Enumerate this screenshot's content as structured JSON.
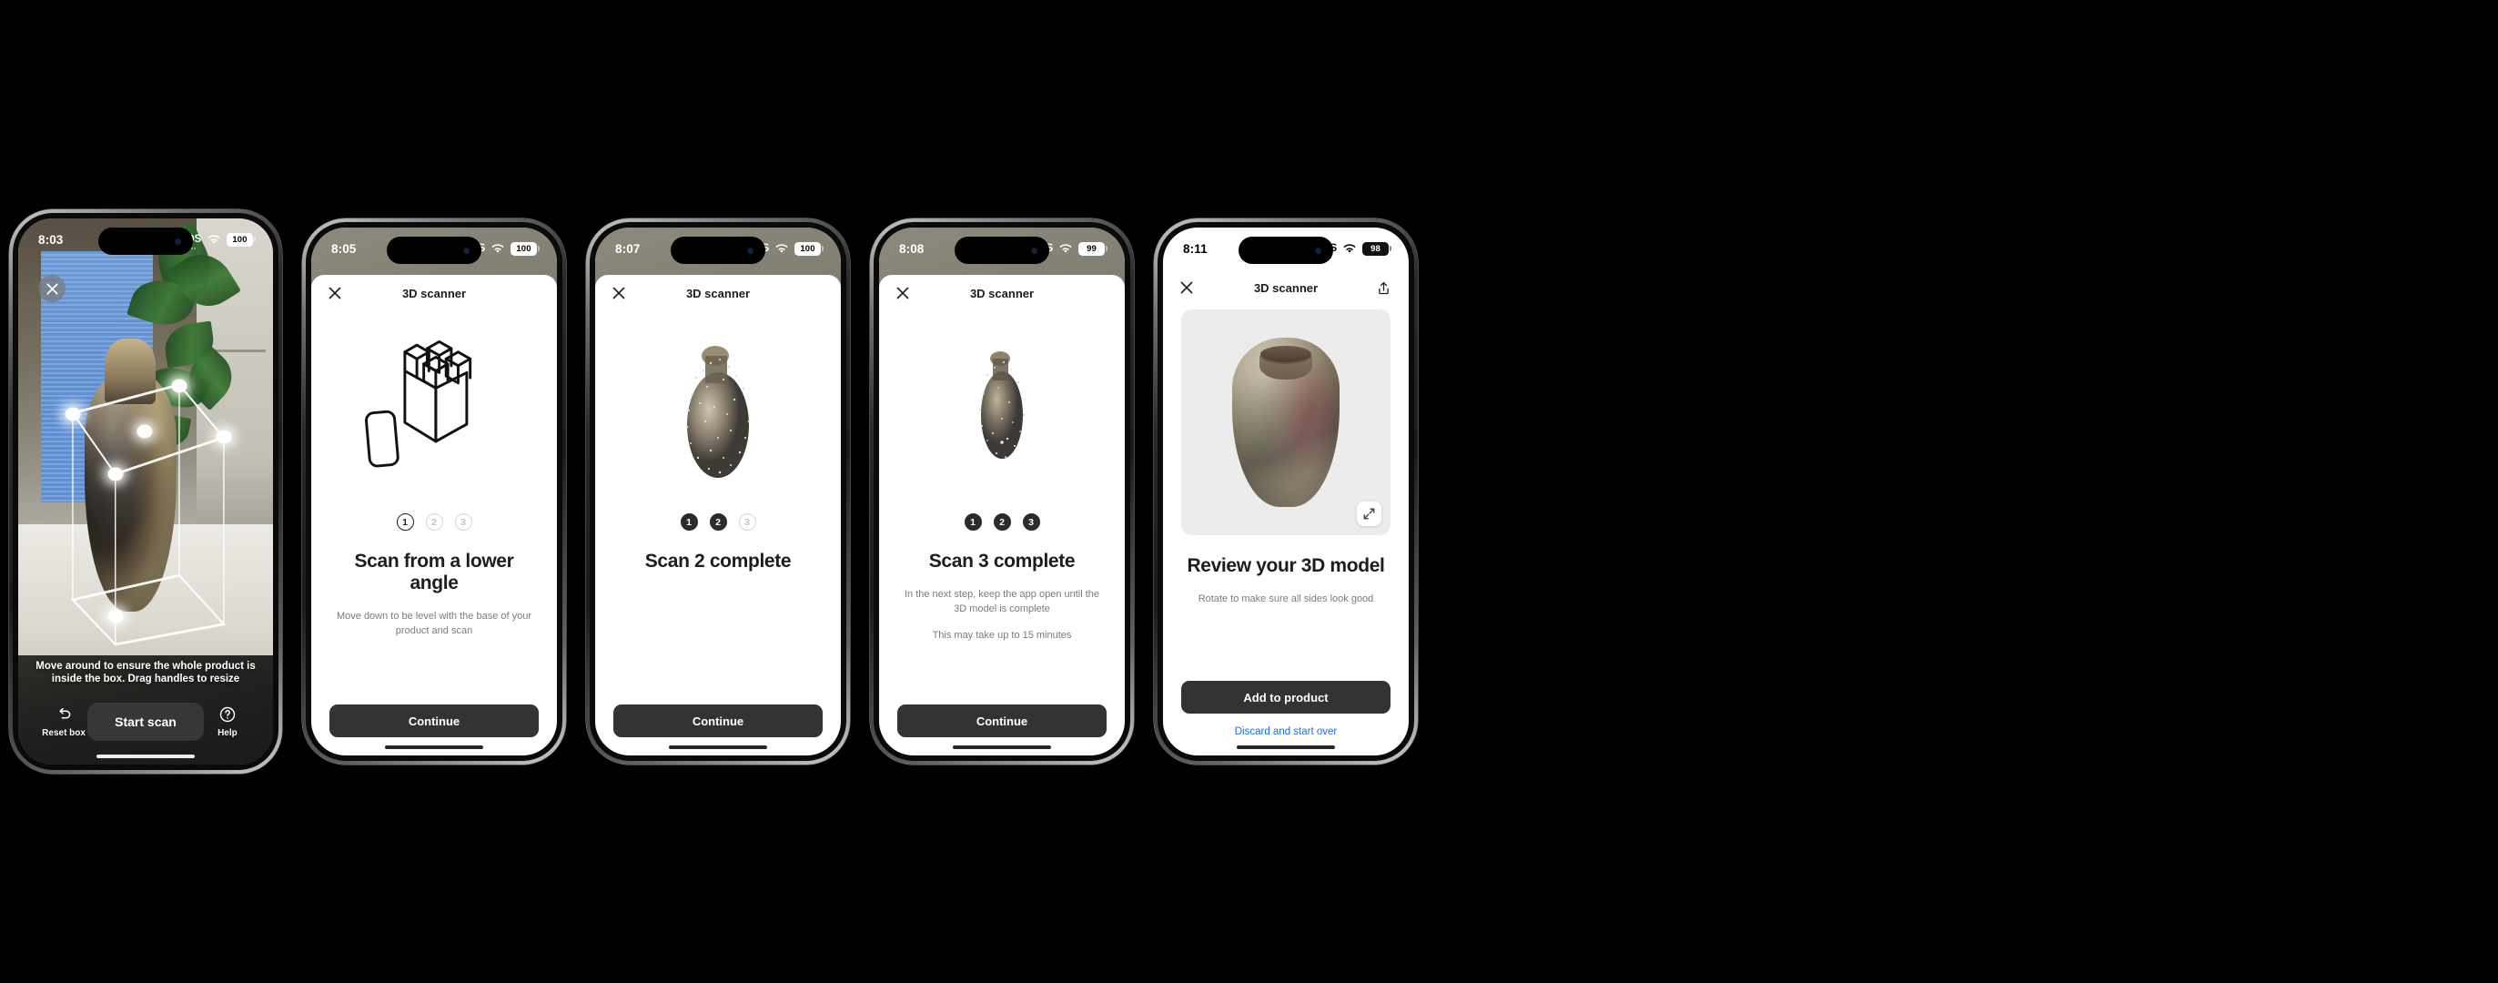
{
  "screens": [
    {
      "id": "ar-box",
      "status": {
        "time": "8:03",
        "sos": "SOS",
        "battery": "100",
        "wifi_icon": "wifi-icon"
      },
      "close_icon": "close-icon",
      "hint": "Move around to ensure the whole product is inside the box. Drag handles to resize",
      "reset": {
        "label": "Reset box",
        "icon": "undo-icon"
      },
      "start": {
        "label": "Start scan"
      },
      "help": {
        "label": "Help",
        "icon": "question-circle-icon"
      }
    },
    {
      "id": "scan-1",
      "status": {
        "time": "8:05",
        "sos": "SOS",
        "battery": "100",
        "wifi_icon": "wifi-icon"
      },
      "title": "3D scanner",
      "close_icon": "close-icon",
      "illustration": "isometric-box-with-phone-icon",
      "steps": [
        {
          "label": "1",
          "state": "current"
        },
        {
          "label": "2",
          "state": "todo"
        },
        {
          "label": "3",
          "state": "todo"
        }
      ],
      "headline": "Scan from a lower angle",
      "subline": "Move down to be level with the base of your product and scan",
      "primary": "Continue"
    },
    {
      "id": "scan-2",
      "status": {
        "time": "8:07",
        "sos": "SOS",
        "battery": "100",
        "wifi_icon": "wifi-icon"
      },
      "title": "3D scanner",
      "close_icon": "close-icon",
      "illustration": "point-cloud-vase",
      "steps": [
        {
          "label": "1",
          "state": "done"
        },
        {
          "label": "2",
          "state": "done"
        },
        {
          "label": "3",
          "state": "todo"
        }
      ],
      "headline": "Scan 2 complete",
      "subline": "",
      "primary": "Continue"
    },
    {
      "id": "scan-3",
      "status": {
        "time": "8:08",
        "sos": "SOS",
        "battery": "99",
        "wifi_icon": "wifi-icon"
      },
      "title": "3D scanner",
      "close_icon": "close-icon",
      "illustration": "point-cloud-vase-small",
      "steps": [
        {
          "label": "1",
          "state": "done"
        },
        {
          "label": "2",
          "state": "done"
        },
        {
          "label": "3",
          "state": "done"
        }
      ],
      "headline": "Scan 3 complete",
      "subline": "In the next step, keep the app open until the 3D model is complete",
      "subline2": "This may take up to 15 minutes",
      "primary": "Continue"
    },
    {
      "id": "review",
      "status": {
        "time": "8:11",
        "sos": "SOS",
        "battery": "98",
        "wifi_icon": "wifi-icon"
      },
      "title": "3D scanner",
      "close_icon": "close-icon",
      "share_icon": "share-icon",
      "expand_icon": "expand-icon",
      "headline": "Review your 3D model",
      "subline": "Rotate to make sure all sides look good",
      "primary": "Add to product",
      "secondary": "Discard and start over"
    }
  ],
  "colors": {
    "primary_button": "#333333",
    "link": "#1d6ae5",
    "step_active": "#2b2b2b",
    "step_inactive": "#d4d4d4",
    "card_bg": "#ececec"
  }
}
